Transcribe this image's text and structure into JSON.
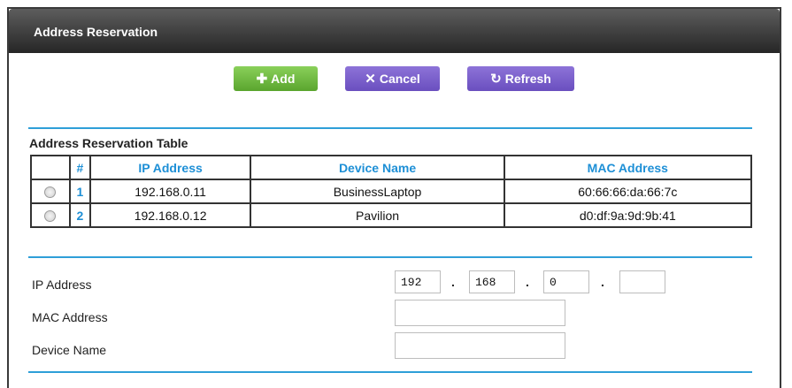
{
  "panel": {
    "title": "Address Reservation"
  },
  "toolbar": {
    "add_label": "Add",
    "cancel_label": "Cancel",
    "refresh_label": "Refresh"
  },
  "table": {
    "caption": "Address Reservation Table",
    "headers": [
      "#",
      "IP Address",
      "Device Name",
      "MAC Address"
    ],
    "rows": [
      {
        "index": "1",
        "ip": "192.168.0.11",
        "device": "BusinessLaptop",
        "mac": "60:66:66:da:66:7c"
      },
      {
        "index": "2",
        "ip": "192.168.0.12",
        "device": "Pavilion",
        "mac": "d0:df:9a:9d:9b:41"
      }
    ]
  },
  "form": {
    "ip_label": "IP Address",
    "mac_label": "MAC Address",
    "device_label": "Device Name",
    "ip_octets": [
      "192",
      "168",
      "0",
      ""
    ],
    "ip_separator": ".",
    "mac_value": "",
    "device_value": ""
  },
  "colors": {
    "accent": "#2e9fd8",
    "header_text": "#1d8fd6",
    "add_button": "#6cbb3c",
    "cancel_button": "#7a5fcb",
    "refresh_button": "#7a5fcb"
  },
  "icons": {
    "add": "plus-icon",
    "cancel": "x-icon",
    "refresh": "refresh-icon"
  }
}
